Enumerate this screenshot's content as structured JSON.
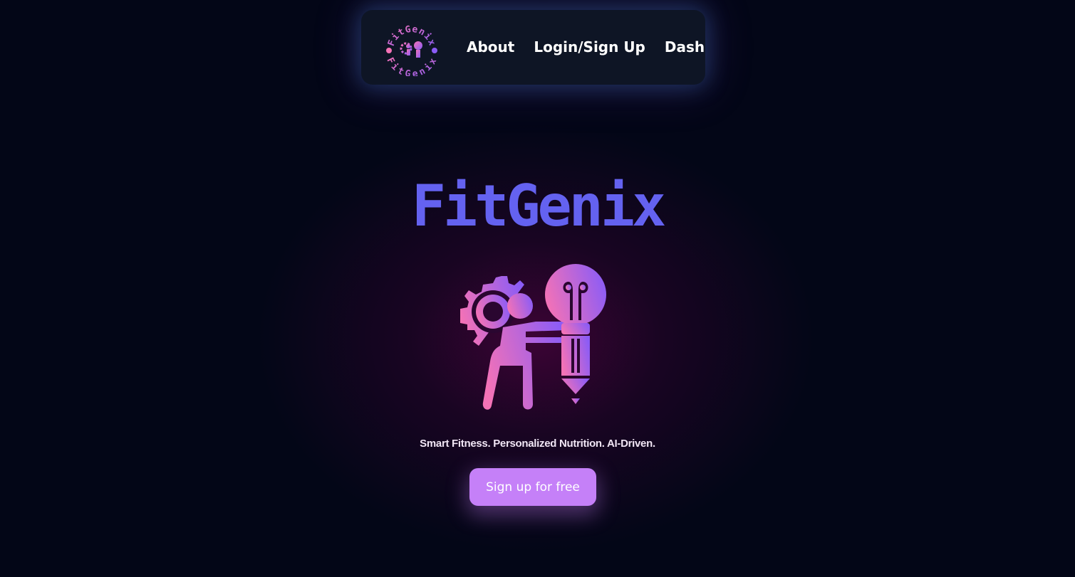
{
  "nav": {
    "logo_text": "FitGenix",
    "items": [
      {
        "label": "About"
      },
      {
        "label": "Login/Sign Up"
      },
      {
        "label": "Dash"
      }
    ]
  },
  "hero": {
    "title": "FitGenix",
    "tagline": "Smart Fitness. Personalized Nutrition. AI-Driven.",
    "cta_label": "Sign up for free"
  },
  "colors": {
    "background": "#030617",
    "navbar": "#0e1525",
    "title": "#6462f0",
    "gradient_start": "#f472b6",
    "gradient_end": "#8b5cf6",
    "cta": "#c580f8"
  },
  "icons": {
    "logo": "fitgenix-logo-icon",
    "hero": "person-gear-lightbulb-pencil-icon"
  }
}
